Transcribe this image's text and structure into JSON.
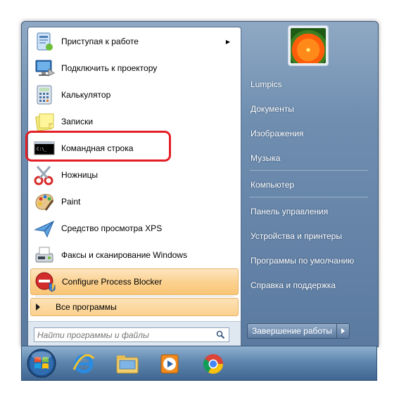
{
  "programs": [
    {
      "label": "Приступая к работе",
      "icon": "getting-started-icon",
      "has_submenu": true
    },
    {
      "label": "Подключить к проектору",
      "icon": "projector-icon",
      "has_submenu": false
    },
    {
      "label": "Калькулятор",
      "icon": "calculator-icon",
      "has_submenu": false
    },
    {
      "label": "Записки",
      "icon": "sticky-notes-icon",
      "has_submenu": false
    },
    {
      "label": "Командная строка",
      "icon": "cmd-icon",
      "has_submenu": false
    },
    {
      "label": "Ножницы",
      "icon": "scissors-icon",
      "has_submenu": false
    },
    {
      "label": "Paint",
      "icon": "paint-icon",
      "has_submenu": false
    },
    {
      "label": "Средство просмотра XPS",
      "icon": "xps-viewer-icon",
      "has_submenu": false
    },
    {
      "label": "Факсы и сканирование Windows",
      "icon": "fax-scan-icon",
      "has_submenu": false
    },
    {
      "label": "Configure Process Blocker",
      "icon": "process-blocker-icon",
      "has_submenu": false
    }
  ],
  "all_programs_label": "Все программы",
  "search_placeholder": "Найти программы и файлы",
  "right_links": [
    "Lumpics",
    "Документы",
    "Изображения",
    "Музыка",
    "Компьютер",
    "Панель управления",
    "Устройства и принтеры",
    "Программы по умолчанию",
    "Справка и поддержка"
  ],
  "shutdown_label": "Завершение работы",
  "taskbar_icons": [
    "start-orb-icon",
    "internet-explorer-icon",
    "explorer-folder-icon",
    "media-player-icon",
    "chrome-icon"
  ],
  "colors": {
    "highlight_outline": "#e31e24",
    "hover_orange": "#fbd08d",
    "menu_blue": "#5b7aa0"
  }
}
